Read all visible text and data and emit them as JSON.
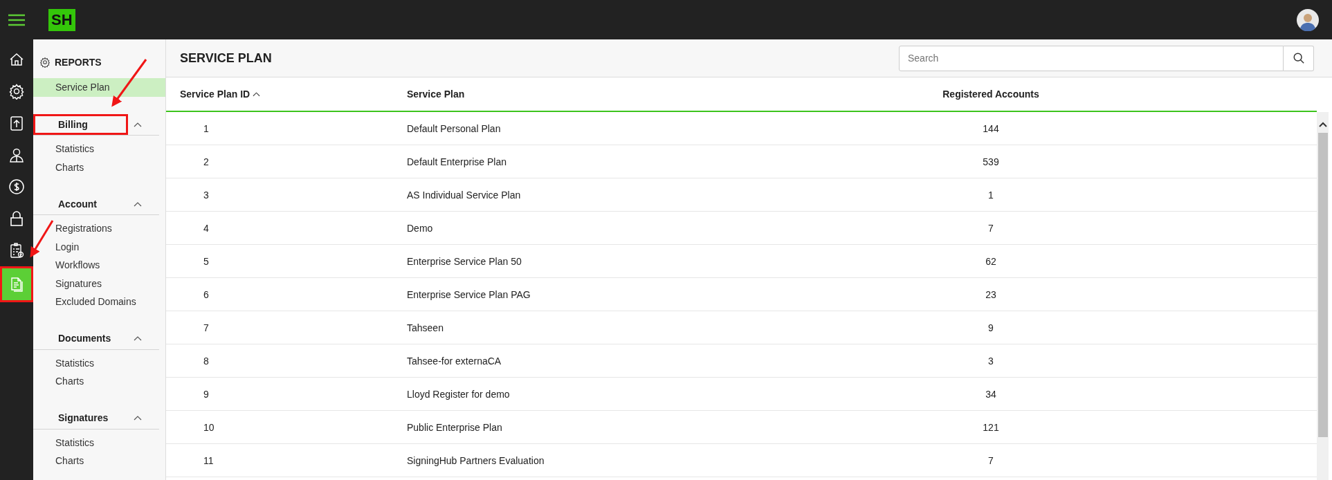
{
  "topbar": {
    "logo": "SH"
  },
  "rail": [
    {
      "kind": "home",
      "selected": false,
      "annotated": false
    },
    {
      "kind": "gear",
      "selected": false,
      "annotated": false
    },
    {
      "kind": "upload",
      "selected": false,
      "annotated": false
    },
    {
      "kind": "person",
      "selected": false,
      "annotated": false
    },
    {
      "kind": "dollar",
      "selected": false,
      "annotated": false
    },
    {
      "kind": "lock",
      "selected": false,
      "annotated": false
    },
    {
      "kind": "clipboard",
      "selected": false,
      "annotated": false
    },
    {
      "kind": "document",
      "selected": true,
      "annotated": true
    }
  ],
  "sidebar": {
    "title": "REPORTS",
    "items": [
      {
        "label": "Service Plan",
        "selected": true
      }
    ],
    "groups": [
      {
        "title": "Billing",
        "expanded": true,
        "annotated": true,
        "items": [
          {
            "label": "Statistics",
            "selected": false
          },
          {
            "label": "Charts",
            "selected": false
          }
        ]
      },
      {
        "title": "Account",
        "expanded": true,
        "annotated": false,
        "items": [
          {
            "label": "Registrations",
            "selected": false
          },
          {
            "label": "Login",
            "selected": false
          },
          {
            "label": "Workflows",
            "selected": false
          },
          {
            "label": "Signatures",
            "selected": false
          },
          {
            "label": "Excluded Domains",
            "selected": false
          }
        ]
      },
      {
        "title": "Documents",
        "expanded": true,
        "annotated": false,
        "items": [
          {
            "label": "Statistics",
            "selected": false
          },
          {
            "label": "Charts",
            "selected": false
          }
        ]
      },
      {
        "title": "Signatures",
        "expanded": true,
        "annotated": false,
        "items": [
          {
            "label": "Statistics",
            "selected": false
          },
          {
            "label": "Charts",
            "selected": false
          }
        ]
      }
    ]
  },
  "page": {
    "title": "SERVICE PLAN",
    "search": {
      "placeholder": "Search"
    }
  },
  "table": {
    "columns": [
      {
        "label": "Service Plan ID",
        "sorted": true
      },
      {
        "label": "Service Plan"
      },
      {
        "label": "Registered Accounts"
      }
    ],
    "rows": [
      [
        "1",
        "Default Personal Plan",
        "144"
      ],
      [
        "2",
        "Default Enterprise Plan",
        "539"
      ],
      [
        "3",
        "AS Individual Service Plan",
        "1"
      ],
      [
        "4",
        "Demo",
        "7"
      ],
      [
        "5",
        "Enterprise Service Plan 50",
        "62"
      ],
      [
        "6",
        "Enterprise Service Plan PAG",
        "23"
      ],
      [
        "7",
        "Tahseen",
        "9"
      ],
      [
        "8",
        "Tahsee-for externaCA",
        "3"
      ],
      [
        "9",
        "Lloyd Register for demo",
        "34"
      ],
      [
        "10",
        "Public Enterprise Plan",
        "121"
      ],
      [
        "11",
        "SigningHub Partners Evaluation",
        "7"
      ]
    ]
  }
}
